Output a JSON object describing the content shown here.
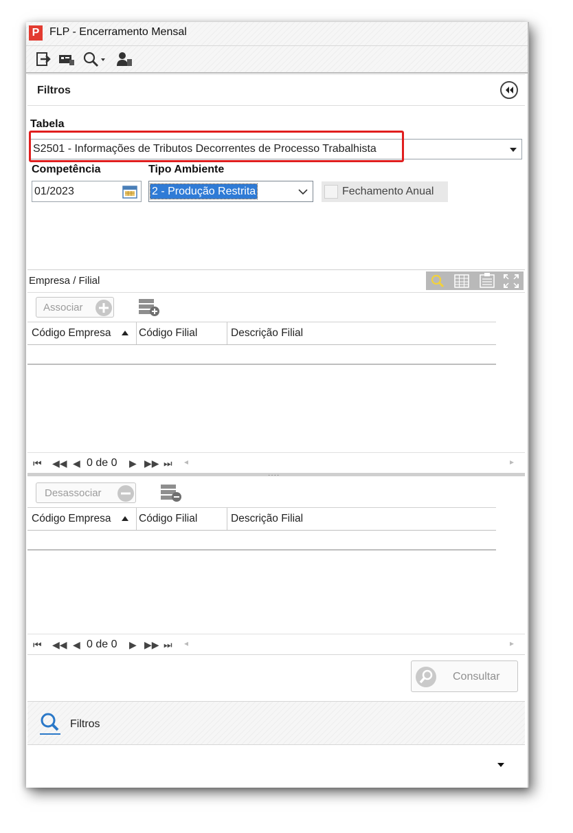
{
  "window": {
    "title": "FLP - Encerramento Mensal",
    "logo_text": "P"
  },
  "toolbar": {
    "icons": [
      "exit-icon",
      "card-icon",
      "search-dropdown-icon",
      "user-icon"
    ]
  },
  "filters_panel": {
    "header": "Filtros",
    "tabela_label": "Tabela",
    "tabela_value": "S2501 - Informações de Tributos Decorrentes de Processo Trabalhista",
    "competencia_label": "Competência",
    "competencia_value": "01/2023",
    "tipo_ambiente_label": "Tipo Ambiente",
    "tipo_ambiente_value": "2 - Produção Restrita",
    "fechamento_anual_label": "Fechamento Anual",
    "fechamento_anual_checked": false
  },
  "empresa_section": {
    "title": "Empresa / Filial",
    "associar_label": "Associar",
    "desassociar_label": "Desassociar",
    "columns": [
      "Código Empresa",
      "Código Filial",
      "Descrição Filial"
    ],
    "pager_text": "0 de 0"
  },
  "footer": {
    "consultar_label": "Consultar",
    "filtros_label": "Filtros"
  },
  "colors": {
    "highlight_red": "#e01e1e",
    "selection_blue": "#2f7bd6",
    "logo_red": "#e23b30"
  }
}
